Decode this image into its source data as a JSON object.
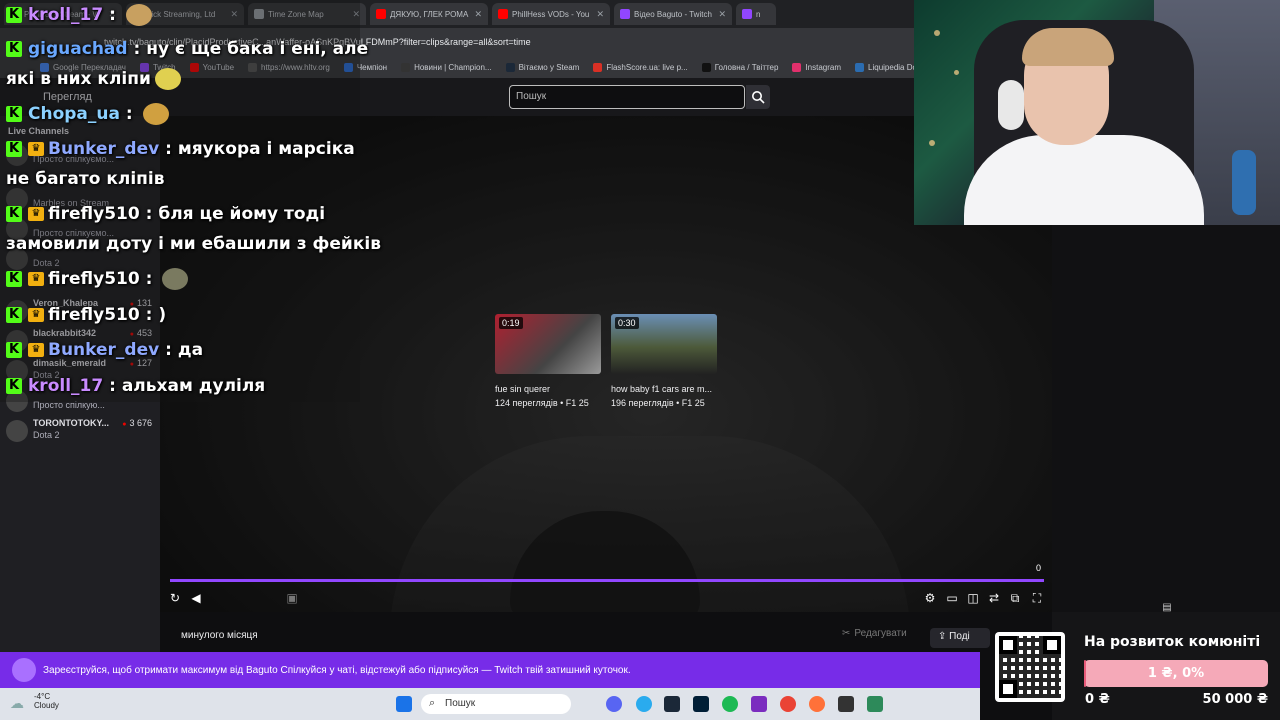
{
  "browser": {
    "tabs": [
      {
        "label": "PhillHess Stream - W",
        "color": "#53fc18"
      },
      {
        "label": "Kick Streaming, Ltd",
        "color": "#3c6df0"
      },
      {
        "label": "Time Zone Map",
        "color": "#9aa0a6"
      },
      {
        "label": "ДЯКУЮ, ГЛЕК РОМА",
        "color": "#ff0000"
      },
      {
        "label": "PhillHess VODs - You",
        "color": "#ff0000"
      },
      {
        "label": "Відео Baguto - Twitch",
        "color": "#9146ff"
      },
      {
        "label": "n",
        "color": "#9146ff"
      }
    ],
    "url": "twitch.tv/baguto/clip/PlacidProductiveC...anWaffer-oASnKPqBVuLFDMmP?filter=clips&range=all&sort=time",
    "bookmarks": [
      "Google Перекладач",
      "Twitch",
      "YouTube",
      "https://www.hltv.org",
      "Чемпіон",
      "Новини | Champion...",
      "Вітаємо у Steam",
      "FlashScore.ua: live p...",
      "Головна / Твіттер",
      "Instagram",
      "Liquipedia Dota 2..."
    ]
  },
  "twitch": {
    "search_placeholder": "Пошук",
    "sidebar_header": "Перегляд",
    "live_channels": "Live Channels",
    "channels": [
      {
        "name": "",
        "game": "Просто спілкуємо..."
      },
      {
        "name": "",
        "game": "Marbles on Stream"
      },
      {
        "name": "",
        "game": "Просто спілкуємо..."
      },
      {
        "name": "",
        "game": "Dota 2"
      },
      {
        "name": "Veron_Khalepa",
        "game": "",
        "viewers": "131"
      },
      {
        "name": "blackrabbit342",
        "game": "",
        "viewers": "453"
      },
      {
        "name": "dimasik_emerald",
        "game": "Dota 2",
        "viewers": "127"
      },
      {
        "name": "",
        "game": "Просто спілкую..."
      },
      {
        "name": "TORONTOTOKY...",
        "game": "Dota 2",
        "viewers": "3 676"
      }
    ],
    "clips": [
      {
        "duration": "0:19",
        "title": "fue sin querer",
        "meta": "124 переглядів • F1 25"
      },
      {
        "duration": "0:30",
        "title": "how baby f1 cars are m...",
        "meta": "196 переглядів • F1 25"
      }
    ],
    "progress_counter": "0",
    "period": "минулого місяця",
    "edit_label": "Редагувати",
    "share_label": "Поді",
    "banner": "Зареєструйся, щоб отримати максимум від Baguto  Спілкуйся у чаті, відстежуй або підписуйся — Twitch твій затишний куточок."
  },
  "chat": [
    {
      "user": "kroll_17",
      "color": "#c98bff",
      "text": "",
      "emote": "#c8a060",
      "line": 0
    },
    {
      "user": "giguachad",
      "color": "#6aa8ff",
      "text": "ну є ще бака і ені, але",
      "line": 1
    },
    {
      "user": "",
      "text": "які в них кліпи",
      "emote": "#e0d050",
      "line": 2
    },
    {
      "user": "Chopa_ua",
      "color": "#8bd1ff",
      "text": "",
      "emote": "#d0a040",
      "line": 3
    },
    {
      "user": "Bunker_dev",
      "color": "#8fa9ff",
      "crown": true,
      "text": "мяукора і марсіка",
      "line": 4
    },
    {
      "user": "",
      "text": "не багато кліпів",
      "line": 5
    },
    {
      "user": "firefly510",
      "color": "#ffffff",
      "crown": true,
      "text": "бля це йому тоді",
      "line": 6
    },
    {
      "user": "",
      "text": "замовили доту і ми ебашили з фейків",
      "line": 7
    },
    {
      "user": "firefly510",
      "color": "#ffffff",
      "crown": true,
      "text": "",
      "emote": "#7a7a60",
      "line": 8
    },
    {
      "user": "firefly510",
      "color": "#ffffff",
      "crown": true,
      "text": ")",
      "line": 9
    },
    {
      "user": "Bunker_dev",
      "color": "#8fa9ff",
      "crown": true,
      "text": "да",
      "line": 10
    },
    {
      "user": "kroll_17",
      "color": "#c98bff",
      "text": "альхам дуліля",
      "line": 11
    }
  ],
  "donation": {
    "title": "На розвиток комюніті",
    "progress_text": "1 ₴, 0%",
    "progress_fraction": 0.002,
    "min_label": "0 ₴",
    "max_label": "50 000 ₴"
  },
  "taskbar": {
    "temperature": "-4°C",
    "weather": "Cloudy",
    "search": "Пошук"
  }
}
